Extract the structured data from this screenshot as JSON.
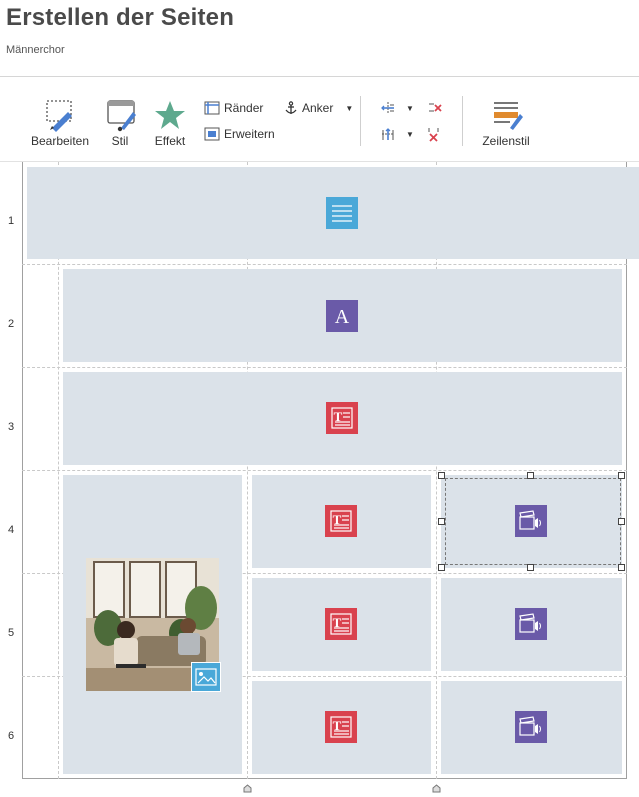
{
  "header": {
    "title": "Erstellen der Seiten",
    "subtitle": "Männerchor"
  },
  "toolbar": {
    "bearbeiten": "Bearbeiten",
    "stil": "Stil",
    "effekt": "Effekt",
    "raender": "Ränder",
    "erweitern": "Erweitern",
    "anker": "Anker",
    "zeilenstil": "Zeilenstil"
  },
  "rows": [
    "1",
    "2",
    "3",
    "4",
    "5",
    "6"
  ],
  "colors": {
    "cell_bg": "#dbe2e9",
    "text_block": "#4aa8d8",
    "heading": "#6a5aa8",
    "text_image": "#d9424e",
    "video": "#6a5aa8",
    "image_badge": "#4aa8d8"
  },
  "blocks": {
    "row1": "text-block-icon",
    "row2": "heading-icon",
    "row3": "text-image-icon",
    "row4_image": "image-icon",
    "row4_col2": "text-image-icon",
    "row4_col3": "video-icon",
    "row5_col2": "text-image-icon",
    "row5_col3": "video-icon",
    "row6_col2": "text-image-icon",
    "row6_col3": "video-icon"
  }
}
